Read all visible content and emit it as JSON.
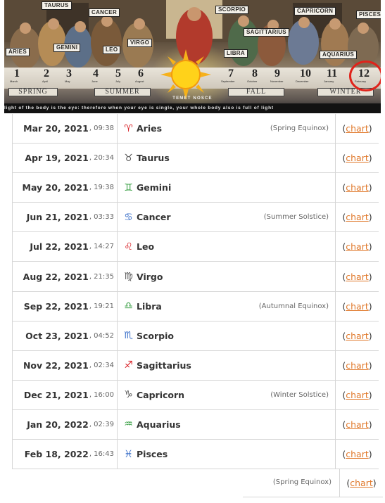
{
  "banner": {
    "zodiac_labels": [
      "TAURUS",
      "CANCER",
      "SCORPIO",
      "CAPRICORN",
      "PISCES",
      "GEMINI",
      "VIRGO",
      "SAGITTARIUS",
      "ARIES",
      "LEO",
      "LIBRA",
      "AQUARIUS"
    ],
    "month_numbers": [
      "1",
      "2",
      "3",
      "4",
      "5",
      "6",
      "7",
      "8",
      "9",
      "10",
      "11",
      "12"
    ],
    "month_names": [
      "March",
      "April",
      "May",
      "June",
      "July",
      "August",
      "September",
      "October",
      "November",
      "December",
      "January",
      "February"
    ],
    "seasons": [
      "SPRING",
      "SUMMER",
      "FALL",
      "WINTER"
    ],
    "motto": "TEMET NOSCE",
    "quote": "light of the body is the eye: therefore when your eye is single, your whole body also is full of light"
  },
  "table": {
    "chart_text": "chart",
    "rows": [
      {
        "date": "Mar 20, 2021",
        "time": ", 09:38",
        "glyph": "♈",
        "glyph_color": "#d9242a",
        "sign": "Aries",
        "event": "(Spring Equinox)"
      },
      {
        "date": "Apr 19, 2021",
        "time": ", 20:34",
        "glyph": "♉",
        "glyph_color": "#555555",
        "sign": "Taurus",
        "event": ""
      },
      {
        "date": "May 20, 2021",
        "time": ", 19:38",
        "glyph": "♊",
        "glyph_color": "#2e9a3a",
        "sign": "Gemini",
        "event": ""
      },
      {
        "date": "Jun 21, 2021",
        "time": ", 03:33",
        "glyph": "♋",
        "glyph_color": "#3a6fc9",
        "sign": "Cancer",
        "event": "(Summer Solstice)"
      },
      {
        "date": "Jul 22, 2021",
        "time": ", 14:27",
        "glyph": "♌",
        "glyph_color": "#d9242a",
        "sign": "Leo",
        "event": ""
      },
      {
        "date": "Aug 22, 2021",
        "time": ", 21:35",
        "glyph": "♍",
        "glyph_color": "#555555",
        "sign": "Virgo",
        "event": ""
      },
      {
        "date": "Sep 22, 2021",
        "time": ", 19:21",
        "glyph": "♎",
        "glyph_color": "#2e9a3a",
        "sign": "Libra",
        "event": "(Autumnal Equinox)"
      },
      {
        "date": "Oct 23, 2021",
        "time": ", 04:52",
        "glyph": "♏",
        "glyph_color": "#3a6fc9",
        "sign": "Scorpio",
        "event": ""
      },
      {
        "date": "Nov 22, 2021",
        "time": ", 02:34",
        "glyph": "♐",
        "glyph_color": "#d9242a",
        "sign": "Sagittarius",
        "event": ""
      },
      {
        "date": "Dec 21, 2021",
        "time": ", 16:00",
        "glyph": "♑",
        "glyph_color": "#555555",
        "sign": "Capricorn",
        "event": "(Winter Solstice)"
      },
      {
        "date": "Jan 20, 2022",
        "time": ", 02:39",
        "glyph": "♒",
        "glyph_color": "#2e9a3a",
        "sign": "Aquarius",
        "event": ""
      },
      {
        "date": "Feb 18, 2022",
        "time": ", 16:43",
        "glyph": "♓",
        "glyph_color": "#3a6fc9",
        "sign": "Pisces",
        "event": ""
      }
    ]
  },
  "extra_row": {
    "event": "(Spring Equinox)"
  },
  "colors": {
    "link": "#e0782a",
    "highlight_ring": "#e0231b"
  }
}
